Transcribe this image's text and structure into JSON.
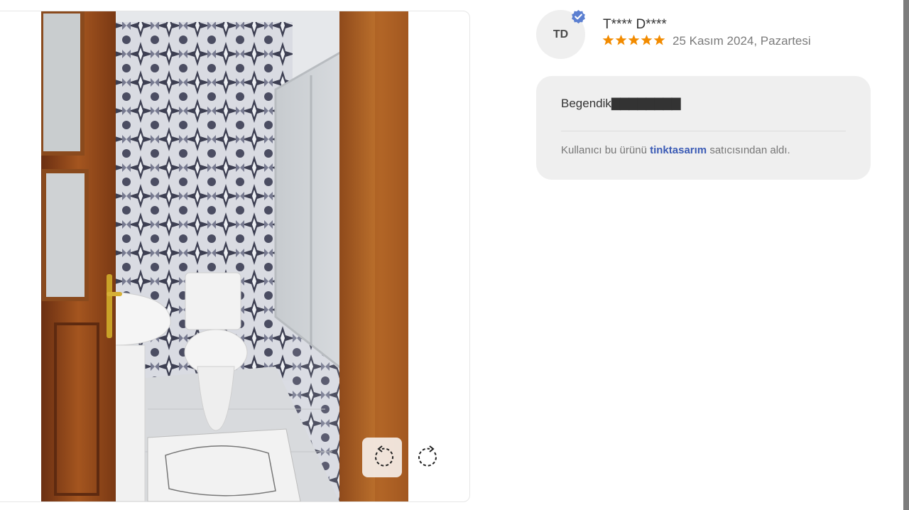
{
  "viewer": {
    "image_subject": "bathroom-photo",
    "rotate_left_icon": "rotate-left-icon",
    "rotate_right_icon": "rotate-right-icon"
  },
  "review": {
    "avatar_initials": "TD",
    "verified_icon": "verified-badge-icon",
    "reviewer_name": "T**** D****",
    "rating": 5,
    "rating_max": 5,
    "date": "25 Kasım 2024, Pazartesi",
    "text": "Begendik",
    "text_tail": "▇▇▇▇▇▇▇▇",
    "purchase_prefix": "Kullanıcı bu ürünü",
    "seller": "tinktasarım",
    "purchase_suffix": "satıcısından aldı."
  },
  "colors": {
    "star": "#f28b00",
    "seller_link": "#3b5bb5",
    "verified": "#5b7fd1",
    "card_bg": "#efefef"
  }
}
